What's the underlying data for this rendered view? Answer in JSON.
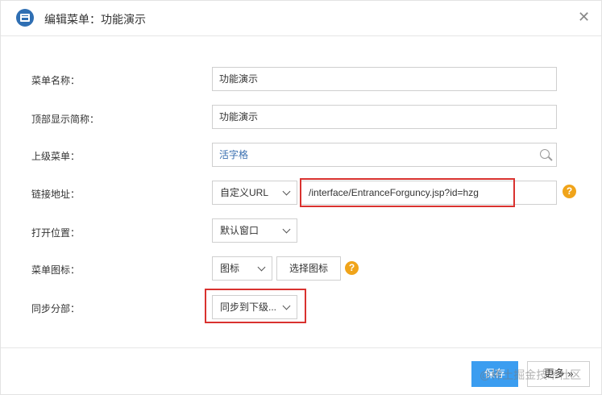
{
  "dialog": {
    "title": "编辑菜单：功能演示",
    "close_glyph": "✕",
    "icon": "menu-edit-icon"
  },
  "form": {
    "name": {
      "label": "菜单名称：",
      "value": "功能演示"
    },
    "display_name": {
      "label": "顶部显示简称：",
      "value": "功能演示"
    },
    "parent": {
      "label": "上级菜单：",
      "value": "活字格"
    },
    "link": {
      "label": "链接地址：",
      "type": "自定义URL",
      "url": "/interface/EntranceForguncy.jsp?id=hzg"
    },
    "open_position": {
      "label": "打开位置：",
      "value": "默认窗口"
    },
    "icon": {
      "label": "菜单图标：",
      "type": "图标",
      "choose_button": "选择图标"
    },
    "sync": {
      "label": "同步分部：",
      "value": "同步到下级..."
    }
  },
  "footer": {
    "save_label": "保存",
    "more_label": "更多 »",
    "watermark": "@稀土掘金技术社区"
  },
  "help_glyph": "?",
  "colors": {
    "accent": "#3b9df0",
    "highlight_box": "#d9322f",
    "help": "#f0a41a",
    "header_icon": "#2f6fb3"
  }
}
